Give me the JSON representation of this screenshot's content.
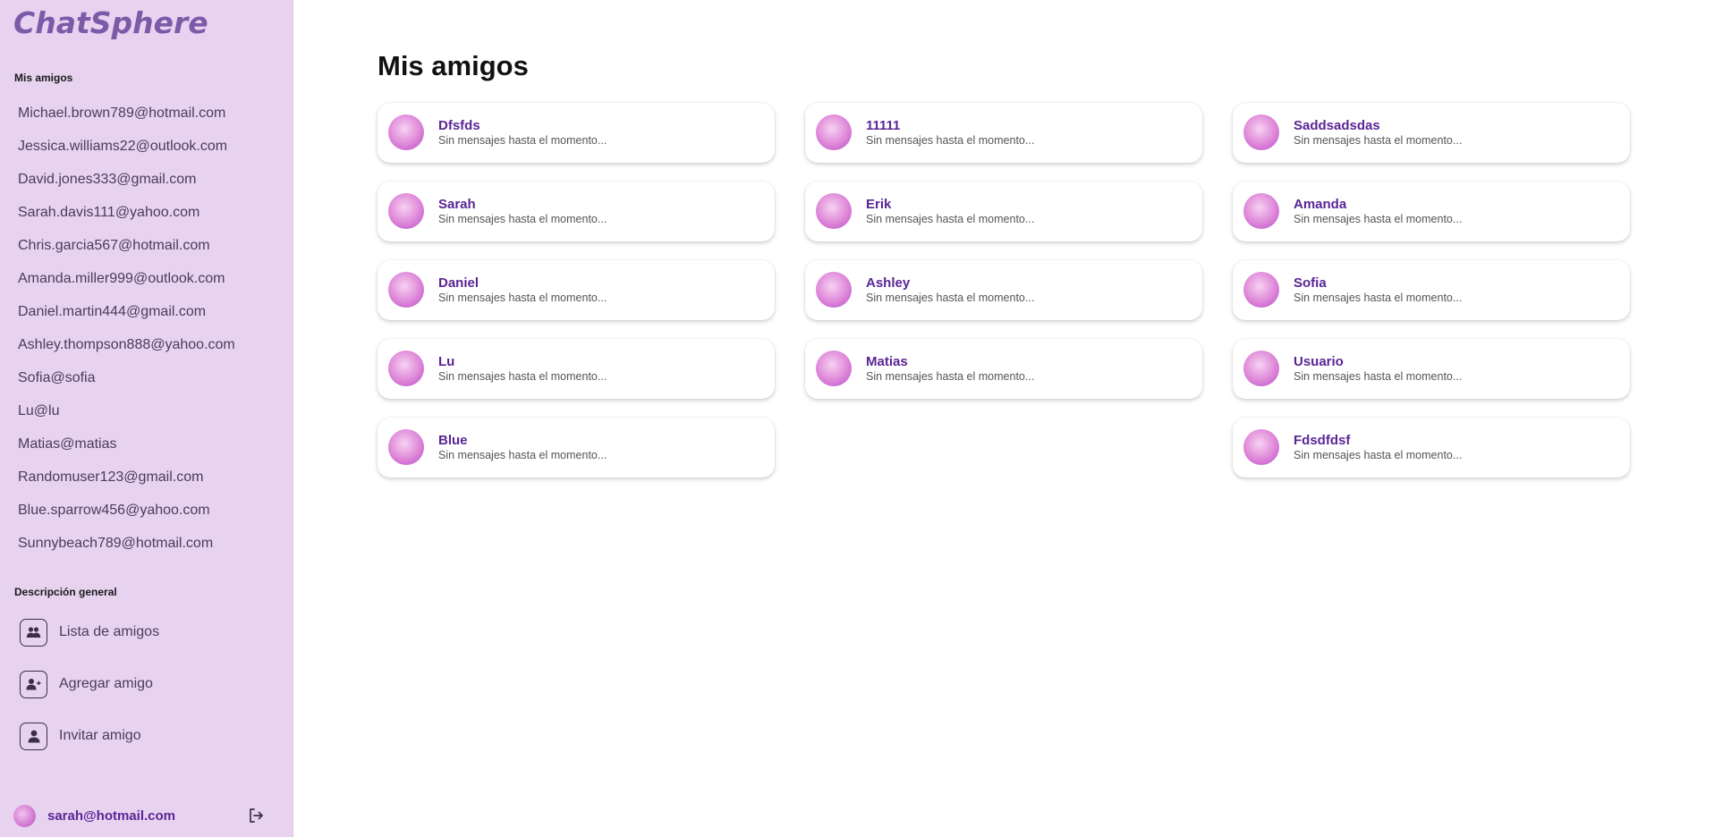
{
  "app": {
    "name": "ChatSphere"
  },
  "sidebar": {
    "friends_title": "Mis amigos",
    "friends": [
      "Michael.brown789@hotmail.com",
      "Jessica.williams22@outlook.com",
      "David.jones333@gmail.com",
      "Sarah.davis111@yahoo.com",
      "Chris.garcia567@hotmail.com",
      "Amanda.miller999@outlook.com",
      "Daniel.martin444@gmail.com",
      "Ashley.thompson888@yahoo.com",
      "Sofia@sofia",
      "Lu@lu",
      "Matias@matias",
      "Randomuser123@gmail.com",
      "Blue.sparrow456@yahoo.com",
      "Sunnybeach789@hotmail.com"
    ],
    "overview_title": "Descripción general",
    "nav": [
      {
        "label": "Lista de amigos",
        "icon": "users-icon"
      },
      {
        "label": "Agregar amigo",
        "icon": "user-plus-icon"
      },
      {
        "label": "Invitar amigo",
        "icon": "user-icon"
      }
    ],
    "user": {
      "email": "sarah@hotmail.com",
      "logout_icon": "logout-icon"
    }
  },
  "main": {
    "title": "Mis amigos",
    "cards": [
      {
        "name": "Dfsfds",
        "message": "Sin mensajes hasta el momento..."
      },
      {
        "name": "11111",
        "message": "Sin mensajes hasta el momento..."
      },
      {
        "name": "Saddsadsdas",
        "message": "Sin mensajes hasta el momento..."
      },
      {
        "name": "Sarah",
        "message": "Sin mensajes hasta el momento..."
      },
      {
        "name": "Erik",
        "message": "Sin mensajes hasta el momento..."
      },
      {
        "name": "Amanda",
        "message": "Sin mensajes hasta el momento..."
      },
      {
        "name": "Daniel",
        "message": "Sin mensajes hasta el momento..."
      },
      {
        "name": "Ashley",
        "message": "Sin mensajes hasta el momento..."
      },
      {
        "name": "Sofia",
        "message": "Sin mensajes hasta el momento..."
      },
      {
        "name": "Lu",
        "message": "Sin mensajes hasta el momento..."
      },
      {
        "name": "Matias",
        "message": "Sin mensajes hasta el momento..."
      },
      {
        "name": "Usuario",
        "message": "Sin mensajes hasta el momento..."
      },
      {
        "name": "Blue",
        "message": "Sin mensajes hasta el momento..."
      },
      {
        "name": "Fdsdfdsf",
        "message": "Sin mensajes hasta el momento..."
      }
    ]
  },
  "colors": {
    "sidebar_bg": "#e7d3f0",
    "accent": "#5a2596",
    "logo": "#7c5aa8"
  }
}
